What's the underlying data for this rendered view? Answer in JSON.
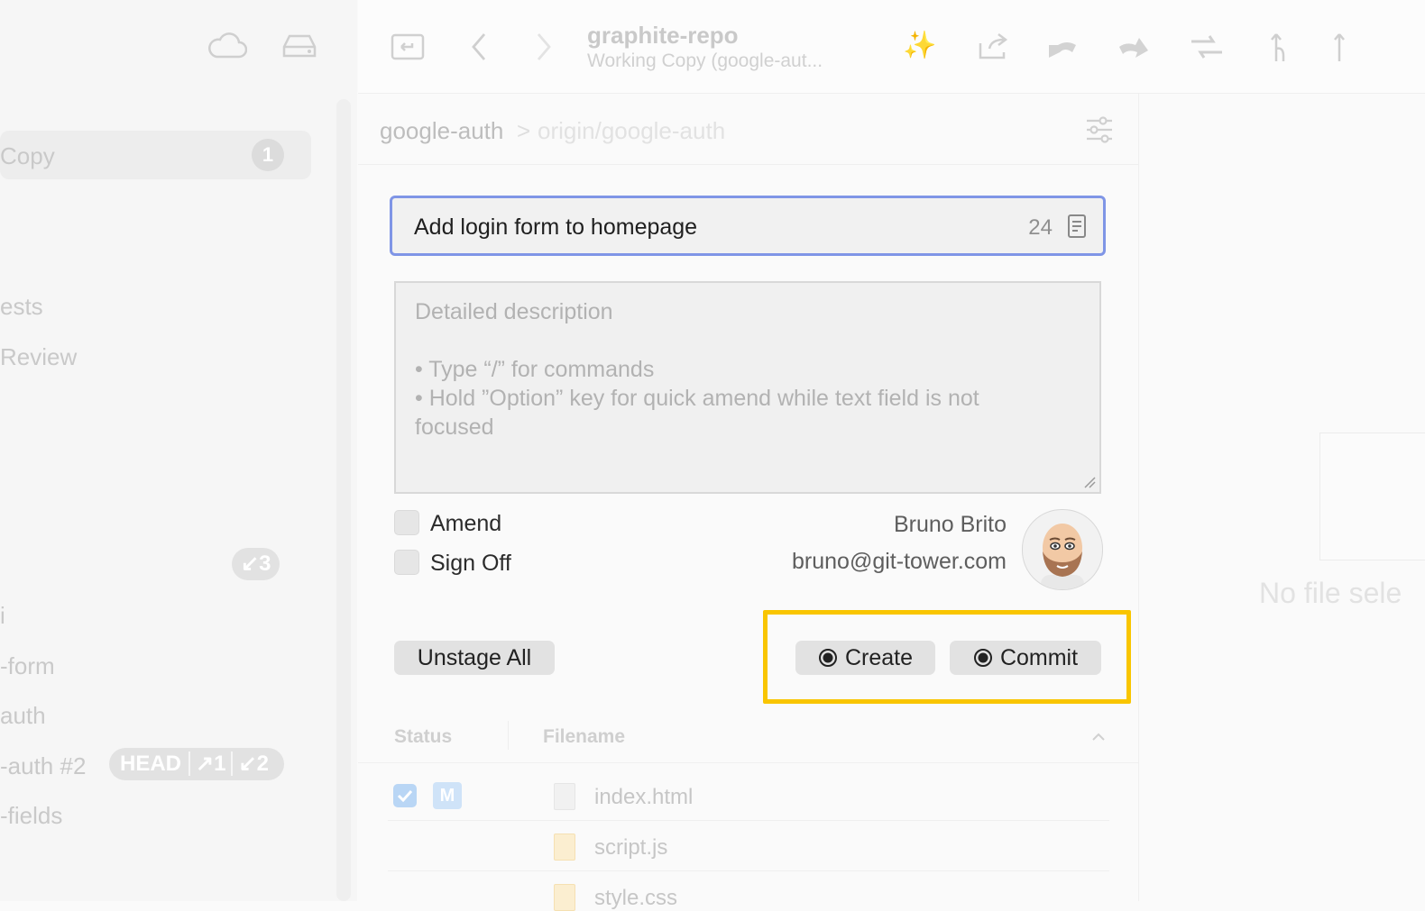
{
  "sidebar": {
    "selected_item": "Copy",
    "selected_count": "1",
    "items": [
      "ests",
      " Review"
    ],
    "branches": [
      {
        "label": "i"
      },
      {
        "label": "-form"
      },
      {
        "label": "auth"
      },
      {
        "label": "-auth #2"
      },
      {
        "label": "-fields"
      }
    ],
    "badge_down3": "↙3",
    "head_badge": "HEAD",
    "head_up": "↗1",
    "head_down": "↙2"
  },
  "toolbar": {
    "repo_name": "graphite-repo",
    "repo_subtitle": "Working Copy (google-aut..."
  },
  "breadcrumb": {
    "local": "google-auth",
    "separator": ">",
    "remote": "origin/google-auth"
  },
  "commit": {
    "summary": "Add login form to homepage",
    "summary_count": "24",
    "description_placeholder": [
      "Detailed description",
      "",
      "• Type “/” for commands",
      "• Hold ”Option” key for quick amend while text field is not",
      "focused"
    ],
    "amend_label": "Amend",
    "signoff_label": "Sign Off",
    "author_name": "Bruno Brito",
    "author_email": "bruno@git-tower.com",
    "unstage_all": "Unstage All",
    "create_label": "Create",
    "commit_label": "Commit"
  },
  "files": {
    "columns": [
      "Status",
      "Filename"
    ],
    "rows": [
      {
        "name": "index.html",
        "status": "M",
        "checked": true
      },
      {
        "name": "script.js"
      },
      {
        "name": "style.css"
      }
    ]
  },
  "right_pane": {
    "empty_text": "No file sele"
  },
  "colors": {
    "focus_border": "#7f95e6",
    "highlight": "#f9c500",
    "checkbox_blue": "#b9d6f5"
  }
}
